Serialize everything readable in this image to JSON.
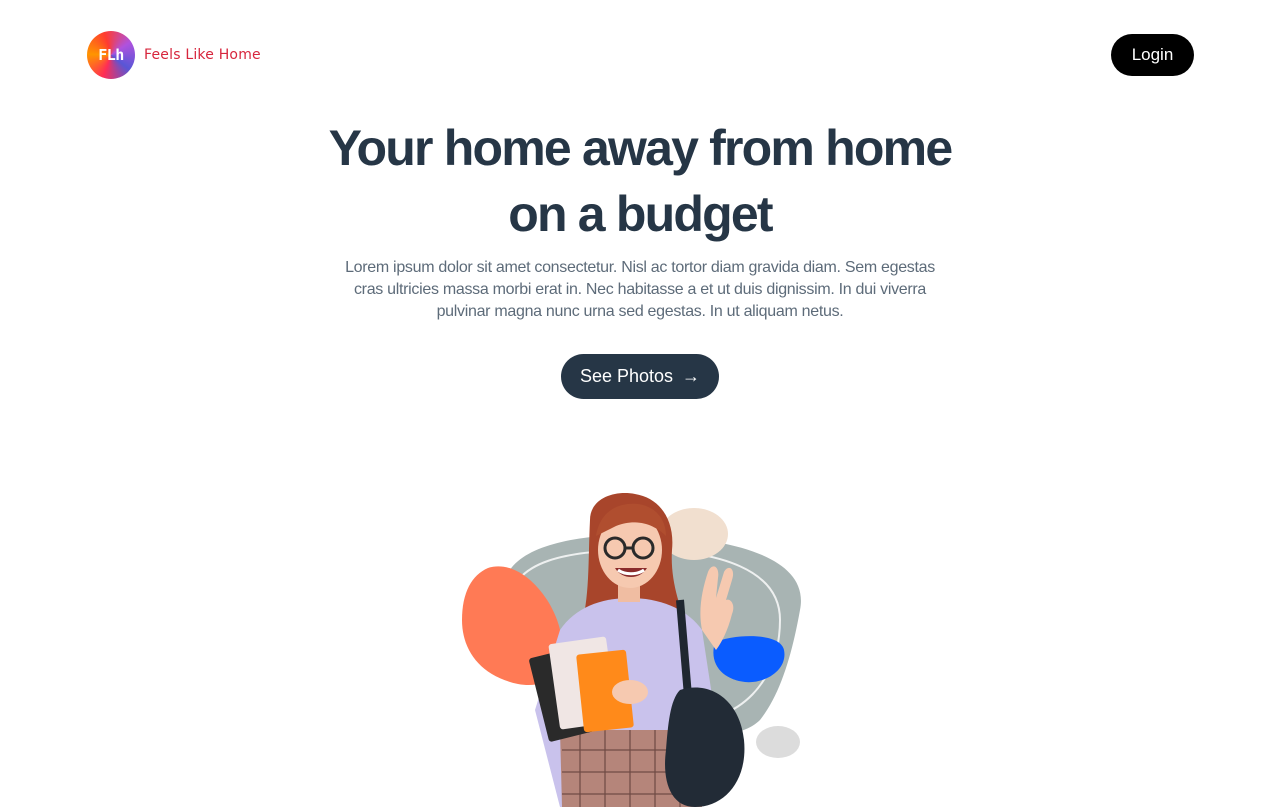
{
  "header": {
    "logo_mark": "FLh",
    "brand_name": "Feels Like Home",
    "login_label": "Login"
  },
  "hero": {
    "title_line1": "Your home away from home",
    "title_line2": "on a budget",
    "description": "Lorem ipsum dolor sit amet consectetur. Nisl ac tortor diam gravida diam. Sem egestas cras ultricies massa morbi erat in. Nec habitasse a et ut duis dignissim. In dui viverra pulvinar magna nunc urna sed egestas. In ut aliquam netus.",
    "cta_label": "See Photos",
    "cta_arrow": "→"
  },
  "colors": {
    "brand_red": "#d7263d",
    "dark_navy": "#263646",
    "blob_orange": "#ff7a55",
    "blob_blue": "#0a5cff",
    "blob_sage": "#a8b4b3",
    "blob_beige": "#f1dfcf"
  },
  "icons": {
    "logo": "flh-gradient-logo",
    "cta": "arrow-right-icon"
  }
}
